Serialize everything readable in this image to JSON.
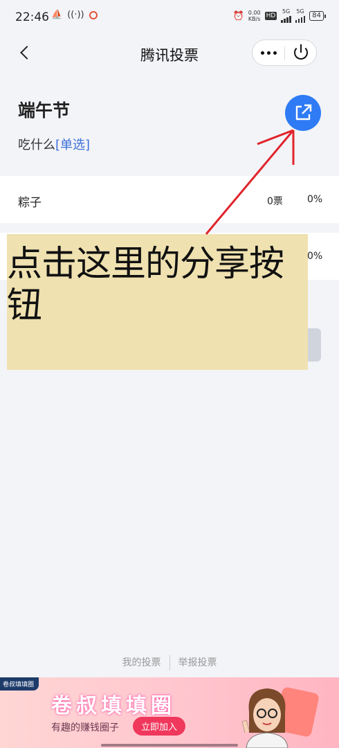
{
  "status_bar": {
    "time": "22:46",
    "speed_value": "0.00",
    "speed_unit": "KB/s",
    "hd_label": "HD",
    "sim1_net": "5G",
    "sim2_net": "5G",
    "battery": "84"
  },
  "nav": {
    "title": "腾讯投票"
  },
  "poll": {
    "title": "端午节",
    "description": "吃什么",
    "type_label": "[单选]",
    "options": [
      {
        "label": "粽子",
        "votes": "0票",
        "percent": "0%"
      },
      {
        "label": "",
        "votes": "",
        "percent": "0%"
      }
    ]
  },
  "annotation": {
    "text": "点击这里的分享按钮",
    "arrow_color": "#e0242b",
    "box_color": "#efe1b0"
  },
  "footer": {
    "my_votes": "我的投票",
    "report": "举报投票"
  },
  "ad": {
    "tag": "卷叔填填圈",
    "title": "卷叔填填圈",
    "subtitle": "有趣的赚钱圈子",
    "cta": "立即加入"
  },
  "colors": {
    "accent": "#2f7bf5",
    "background": "#f3f4f8",
    "link": "#3a6fd8"
  }
}
